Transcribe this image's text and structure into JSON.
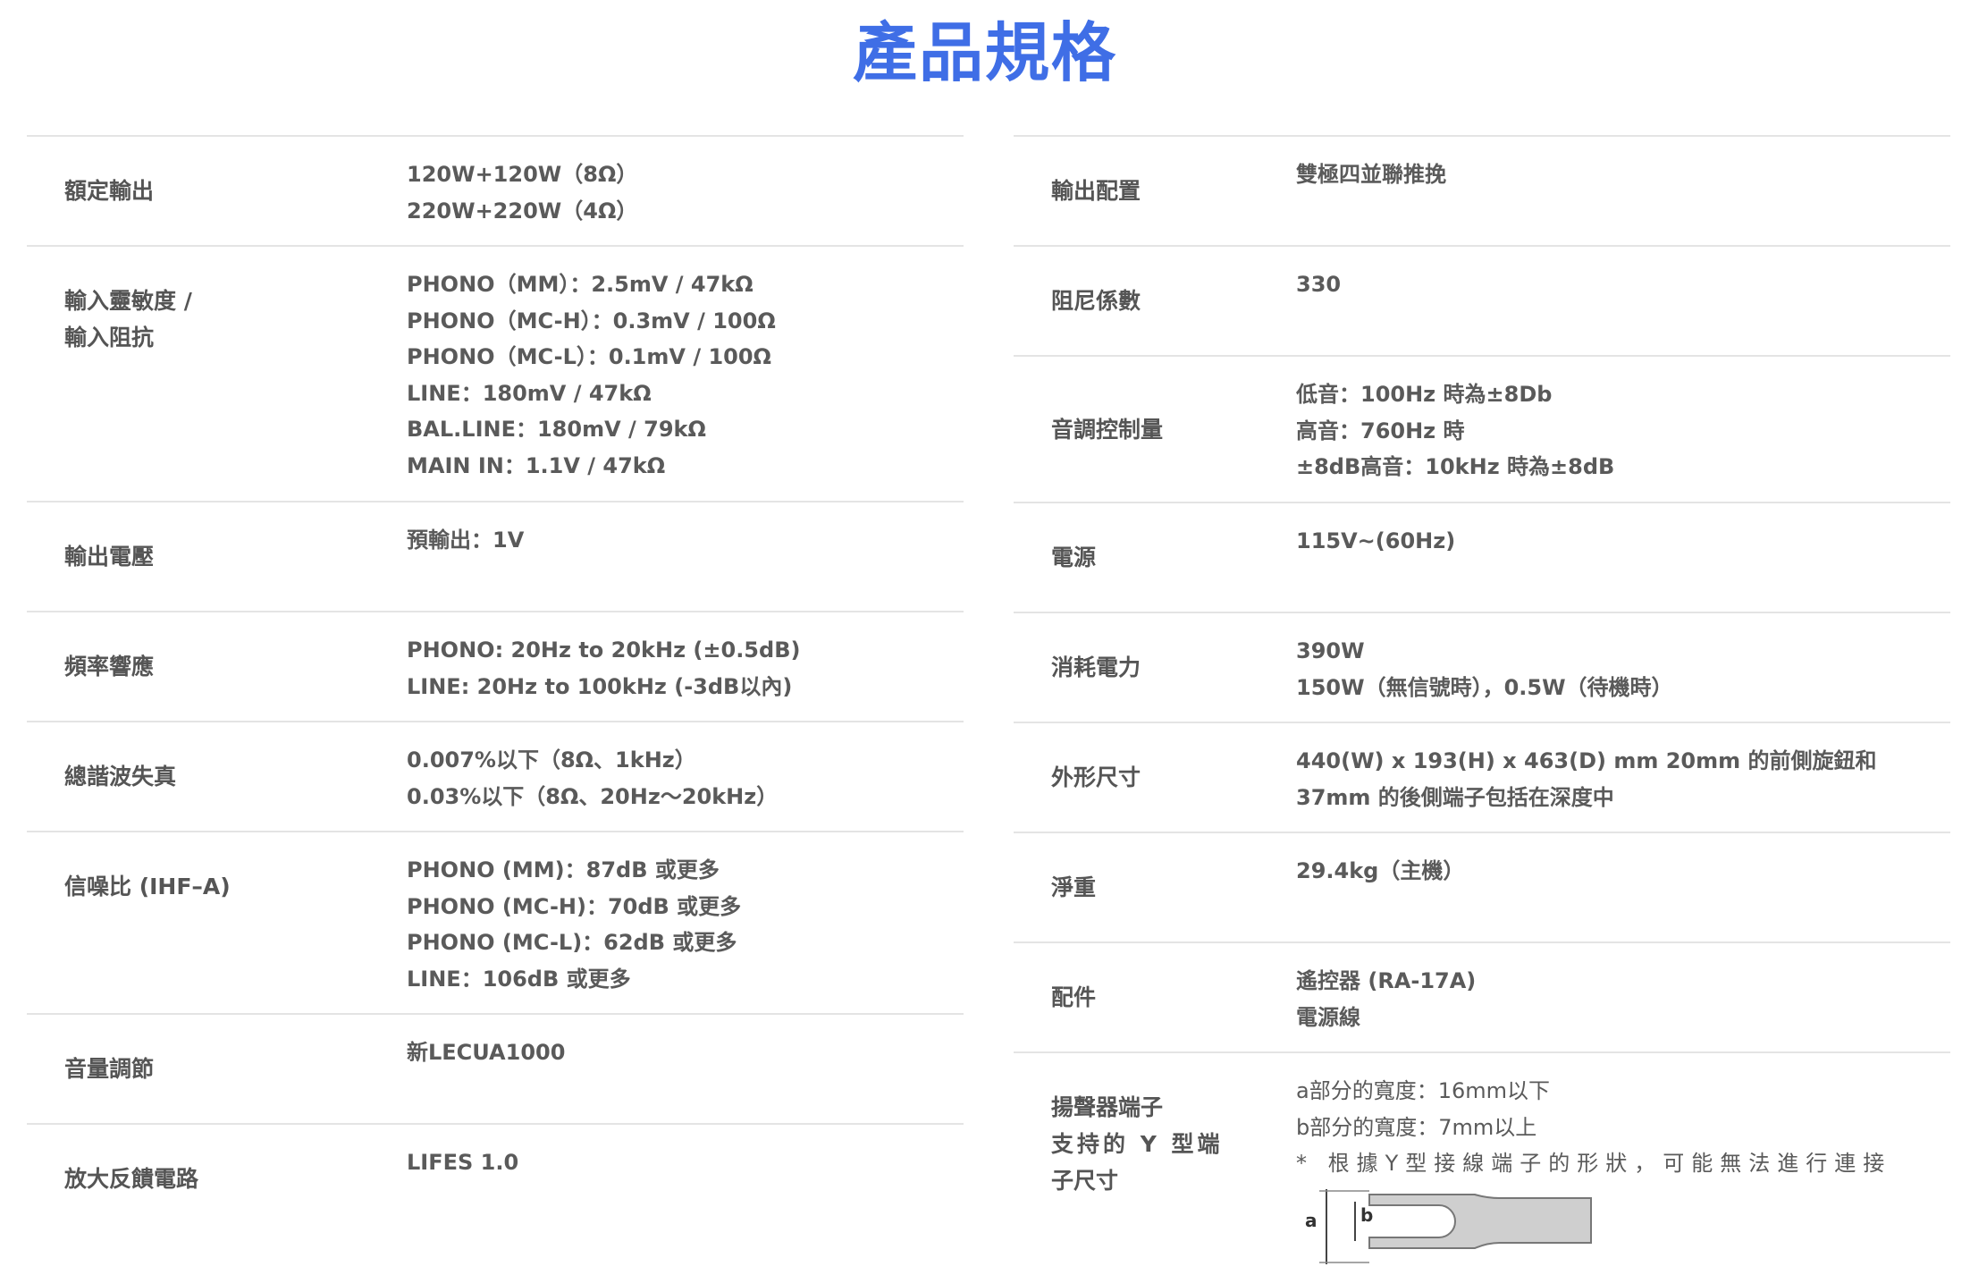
{
  "title": "產品規格",
  "left": [
    {
      "label": [
        "額定輸出"
      ],
      "values": [
        "120W+120W（8Ω）",
        "220W+220W（4Ω）"
      ]
    },
    {
      "label": [
        "輸入靈敏度 /",
        "輸入阻抗"
      ],
      "values": [
        "PHONO（MM）：2.5mV / 47kΩ",
        "PHONO（MC-H）：0.3mV / 100Ω",
        "PHONO（MC-L）：0.1mV / 100Ω",
        "LINE：180mV / 47kΩ",
        "BAL.LINE：180mV / 79kΩ",
        "MAIN IN：1.1V / 47kΩ"
      ]
    },
    {
      "label": [
        "輸出電壓"
      ],
      "values": [
        "預輸出：1V"
      ]
    },
    {
      "label": [
        "頻率響應"
      ],
      "values": [
        "PHONO: 20Hz to 20kHz (±0.5dB)",
        "LINE: 20Hz to 100kHz (-3dB以內)"
      ]
    },
    {
      "label": [
        "總諧波失真"
      ],
      "values": [
        "0.007%以下（8Ω、1kHz）",
        "0.03%以下（8Ω、20Hz～20kHz）"
      ]
    },
    {
      "label": [
        "信噪比 (IHF–A)"
      ],
      "values": [
        "PHONO (MM)：87dB 或更多",
        "PHONO (MC-H)：70dB 或更多",
        "PHONO (MC-L)：62dB 或更多",
        "LINE：106dB 或更多"
      ]
    },
    {
      "label": [
        "音量調節"
      ],
      "values": [
        "新LECUA1000"
      ]
    },
    {
      "label": [
        "放大反饋電路"
      ],
      "values": [
        "LIFES 1.0"
      ]
    }
  ],
  "right": [
    {
      "label": [
        "輸出配置"
      ],
      "values": [
        "雙極四並聯推挽"
      ]
    },
    {
      "label": [
        "阻尼係數"
      ],
      "values": [
        "330"
      ]
    },
    {
      "label": [
        "音調控制量"
      ],
      "values": [
        "低音：100Hz 時為±8Db",
        "高音：760Hz 時",
        "±8dB高音：10kHz 時為±8dB"
      ]
    },
    {
      "label": [
        "電源"
      ],
      "values": [
        "115V~(60Hz)"
      ]
    },
    {
      "label": [
        "消耗電力"
      ],
      "values": [
        "390W",
        "150W（無信號時），0.5W（待機時）"
      ]
    },
    {
      "label": [
        "外形尺寸"
      ],
      "values": [
        "440(W) x 193(H) x 463(D) mm 20mm 的前側旋鈕和37mm 的後側端子包括在深度中"
      ]
    },
    {
      "label": [
        "淨重"
      ],
      "values": [
        "29.4kg（主機）"
      ]
    },
    {
      "label": [
        "配件"
      ],
      "values": [
        "遙控器 (RA-17A)",
        "電源線"
      ]
    },
    {
      "label": [
        "揚聲器端子",
        "支持的 Y 型端",
        "子尺寸"
      ],
      "values": [
        "a部分的寬度：16mm以下",
        "b部分的寬度：7mm以上",
        "* 根據Y型接線端子的形狀，可能無法進行連接"
      ],
      "diagram_labels": [
        "a",
        "b"
      ]
    }
  ]
}
